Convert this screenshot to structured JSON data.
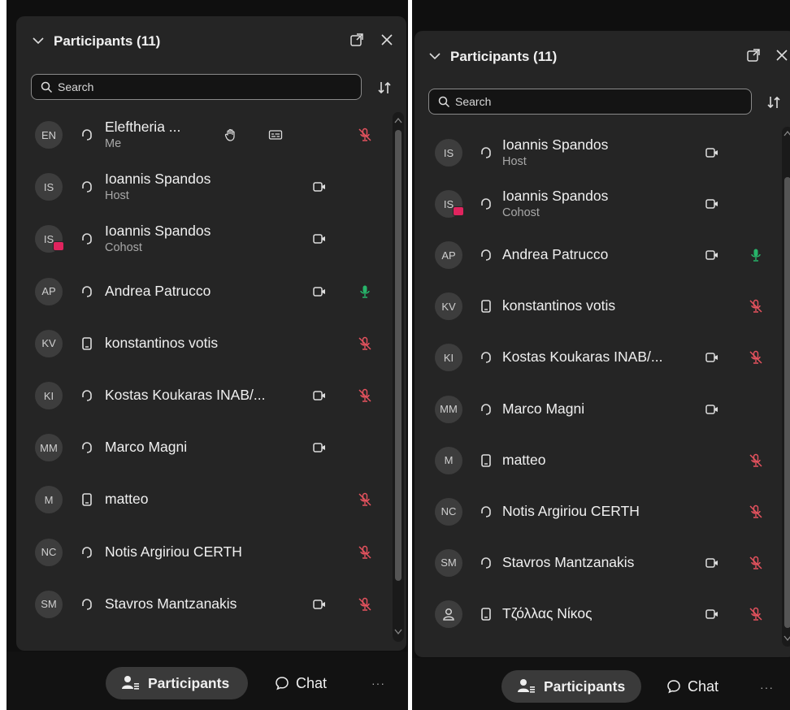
{
  "panels": [
    {
      "id": "left",
      "title": "Participants (11)",
      "search_placeholder": "Search",
      "participants": [
        {
          "initials": "EN",
          "name": "Eleftheria ...",
          "role": "Me",
          "device": "headset",
          "video": false,
          "mic": "muted",
          "badge": false,
          "hand": true,
          "cc": true
        },
        {
          "initials": "IS",
          "name": "Ioannis Spandos",
          "role": "Host",
          "device": "headset",
          "video": true,
          "mic": "none",
          "badge": false
        },
        {
          "initials": "IS",
          "name": "Ioannis Spandos",
          "role": "Cohost",
          "device": "headset",
          "video": true,
          "mic": "none",
          "badge": true
        },
        {
          "initials": "AP",
          "name": "Andrea Patrucco",
          "role": "",
          "device": "headset",
          "video": true,
          "mic": "active",
          "badge": false
        },
        {
          "initials": "KV",
          "name": "konstantinos votis",
          "role": "",
          "device": "phone",
          "video": false,
          "mic": "muted",
          "badge": false
        },
        {
          "initials": "KI",
          "name": "Kostas Koukaras INAB/...",
          "role": "",
          "device": "headset",
          "video": true,
          "mic": "muted",
          "badge": false
        },
        {
          "initials": "MM",
          "name": "Marco Magni",
          "role": "",
          "device": "headset",
          "video": true,
          "mic": "none",
          "badge": false
        },
        {
          "initials": "M",
          "name": "matteo",
          "role": "",
          "device": "phone",
          "video": false,
          "mic": "muted",
          "badge": false
        },
        {
          "initials": "NC",
          "name": "Notis Argiriou CERTH",
          "role": "",
          "device": "headset",
          "video": false,
          "mic": "muted",
          "badge": false
        },
        {
          "initials": "SM",
          "name": "Stavros Mantzanakis",
          "role": "",
          "device": "headset",
          "video": true,
          "mic": "muted",
          "badge": false
        }
      ],
      "participants_button": "Participants",
      "chat_button": "Chat",
      "more_label": "···"
    },
    {
      "id": "right",
      "title": "Participants (11)",
      "search_placeholder": "Search",
      "participants": [
        {
          "initials": "IS",
          "name": "Ioannis Spandos",
          "role": "Host",
          "device": "headset",
          "video": true,
          "mic": "none",
          "badge": false
        },
        {
          "initials": "IS",
          "name": "Ioannis Spandos",
          "role": "Cohost",
          "device": "headset",
          "video": true,
          "mic": "none",
          "badge": true
        },
        {
          "initials": "AP",
          "name": "Andrea Patrucco",
          "role": "",
          "device": "headset",
          "video": true,
          "mic": "active",
          "badge": false
        },
        {
          "initials": "KV",
          "name": "konstantinos votis",
          "role": "",
          "device": "phone",
          "video": false,
          "mic": "muted",
          "badge": false
        },
        {
          "initials": "KI",
          "name": "Kostas Koukaras INAB/...",
          "role": "",
          "device": "headset",
          "video": true,
          "mic": "muted",
          "badge": false
        },
        {
          "initials": "MM",
          "name": "Marco Magni",
          "role": "",
          "device": "headset",
          "video": true,
          "mic": "none",
          "badge": false
        },
        {
          "initials": "M",
          "name": "matteo",
          "role": "",
          "device": "phone",
          "video": false,
          "mic": "muted",
          "badge": false
        },
        {
          "initials": "NC",
          "name": "Notis Argiriou CERTH",
          "role": "",
          "device": "headset",
          "video": false,
          "mic": "muted",
          "badge": false
        },
        {
          "initials": "SM",
          "name": "Stavros Mantzanakis",
          "role": "",
          "device": "headset",
          "video": true,
          "mic": "muted",
          "badge": false
        },
        {
          "initials": "",
          "name": "Τζόλλας Νίκος",
          "role": "",
          "device": "phone",
          "video": true,
          "mic": "muted",
          "badge": false,
          "person_icon": true
        }
      ],
      "participants_button": "Participants",
      "chat_button": "Chat",
      "more_label": "···"
    }
  ],
  "colors": {
    "muted_mic": "#e8535f",
    "active_mic": "#27b46a",
    "badge": "#e0245e"
  }
}
